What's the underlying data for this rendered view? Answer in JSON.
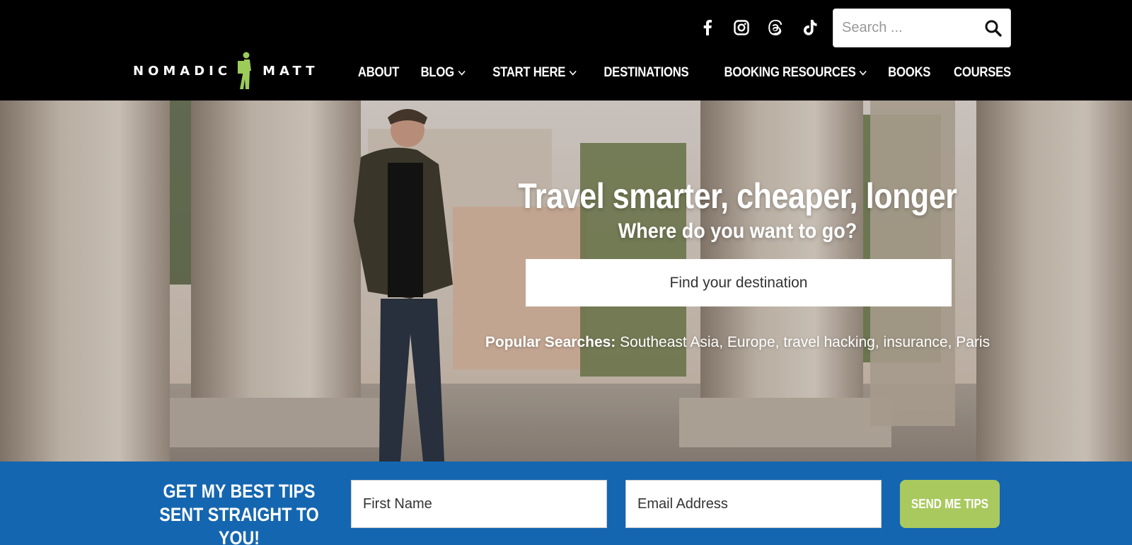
{
  "brand": {
    "left_word": "NOMADIC",
    "right_word": "MATT",
    "accent": "#9ccb5a"
  },
  "social": [
    {
      "name": "facebook-icon"
    },
    {
      "name": "instagram-icon"
    },
    {
      "name": "threads-icon"
    },
    {
      "name": "tiktok-icon"
    }
  ],
  "search": {
    "placeholder": "Search ..."
  },
  "nav": {
    "items": [
      {
        "label": "ABOUT",
        "dropdown": false
      },
      {
        "label": "BLOG",
        "dropdown": true
      },
      {
        "label": "START HERE",
        "dropdown": true
      },
      {
        "label": "DESTINATIONS",
        "dropdown": false
      },
      {
        "label": "BOOKING RESOURCES",
        "dropdown": true
      },
      {
        "label": "BOOKS",
        "dropdown": false
      },
      {
        "label": "COURSES",
        "dropdown": false
      }
    ]
  },
  "hero": {
    "title": "Travel smarter, cheaper, longer",
    "subtitle": "Where do you want to go?",
    "destination_placeholder": "Find your destination",
    "popular_label": "Popular Searches:",
    "popular_terms": "Southeast Asia, Europe, travel hacking, insurance, Paris"
  },
  "newsletter": {
    "heading": "GET MY BEST TIPS SENT STRAIGHT TO YOU!",
    "first_name_placeholder": "First Name",
    "email_placeholder": "Email Address",
    "button_label": "SEND ME TIPS",
    "background": "#1566b0",
    "button_color": "#a9c95e"
  }
}
